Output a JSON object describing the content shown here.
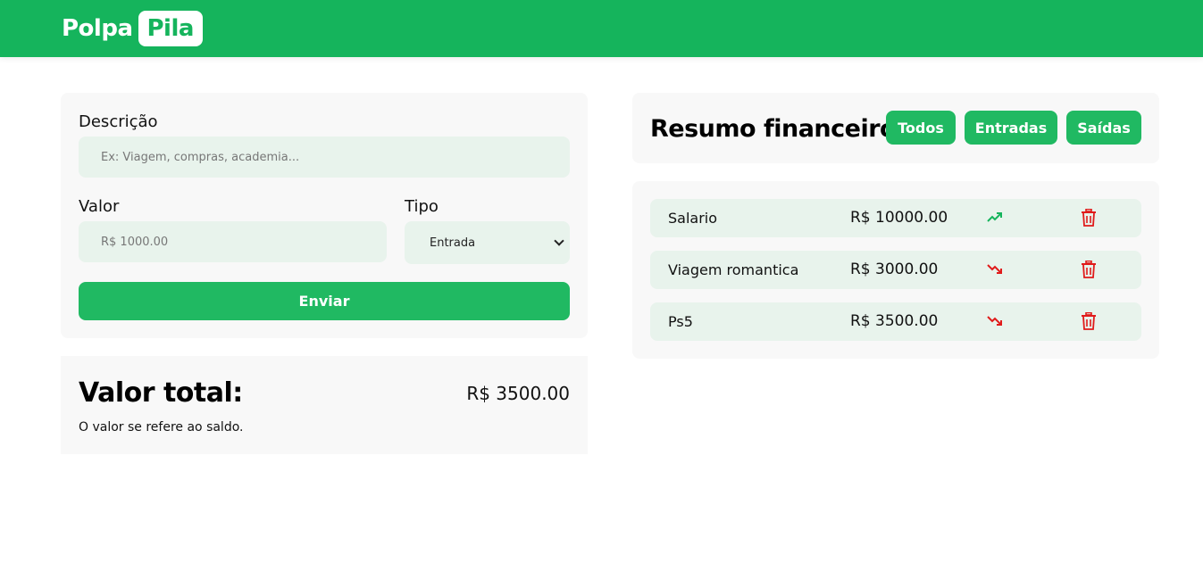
{
  "brand": {
    "part1": "Polpa",
    "part2": "Pila"
  },
  "form": {
    "description_label": "Descrição",
    "description_placeholder": "Ex: Viagem, compras, academia...",
    "value_label": "Valor",
    "value_placeholder": "R$ 1000.00",
    "type_label": "Tipo",
    "type_selected": "Entrada",
    "submit_label": "Enviar"
  },
  "total": {
    "title": "Valor total:",
    "value": "R$ 3500.00",
    "note": "O valor se refere ao saldo."
  },
  "summary": {
    "title": "Resumo financeiro",
    "filters": [
      "Todos",
      "Entradas",
      "Saídas"
    ]
  },
  "transactions": [
    {
      "description": "Salario",
      "value": "R$ 10000.00",
      "trend": "trending-up-icon"
    },
    {
      "description": "Viagem romantica",
      "value": "R$ 3000.00",
      "trend": "trending-down-icon"
    },
    {
      "description": "Ps5",
      "value": "R$ 3500.00",
      "trend": "trending-down-icon"
    }
  ],
  "colors": {
    "brand_green": "#15b45c",
    "button_green": "#20b962",
    "field_bg": "#e8f3ec",
    "card_bg": "#f8f8f8",
    "income": "#15b45c",
    "expense": "#e01b1b"
  }
}
